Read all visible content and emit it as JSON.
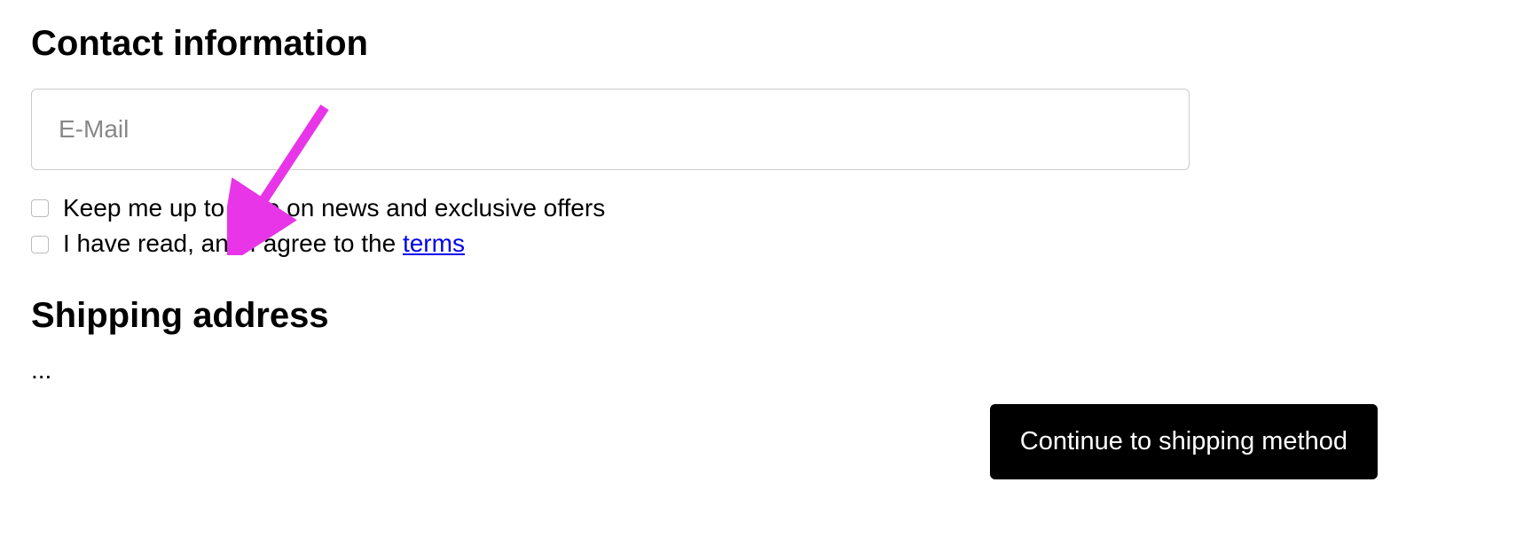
{
  "contact": {
    "heading": "Contact information",
    "email_placeholder": "E-Mail",
    "email_value": "",
    "newsletter_label": "Keep me up to date on news and exclusive offers",
    "terms_label_prefix": "I have read, and I agree to the ",
    "terms_link_text": "terms"
  },
  "shipping": {
    "heading": "Shipping address",
    "placeholder": "..."
  },
  "actions": {
    "continue_label": "Continue to shipping method"
  },
  "annotation": {
    "arrow_color": "#E835E8"
  }
}
